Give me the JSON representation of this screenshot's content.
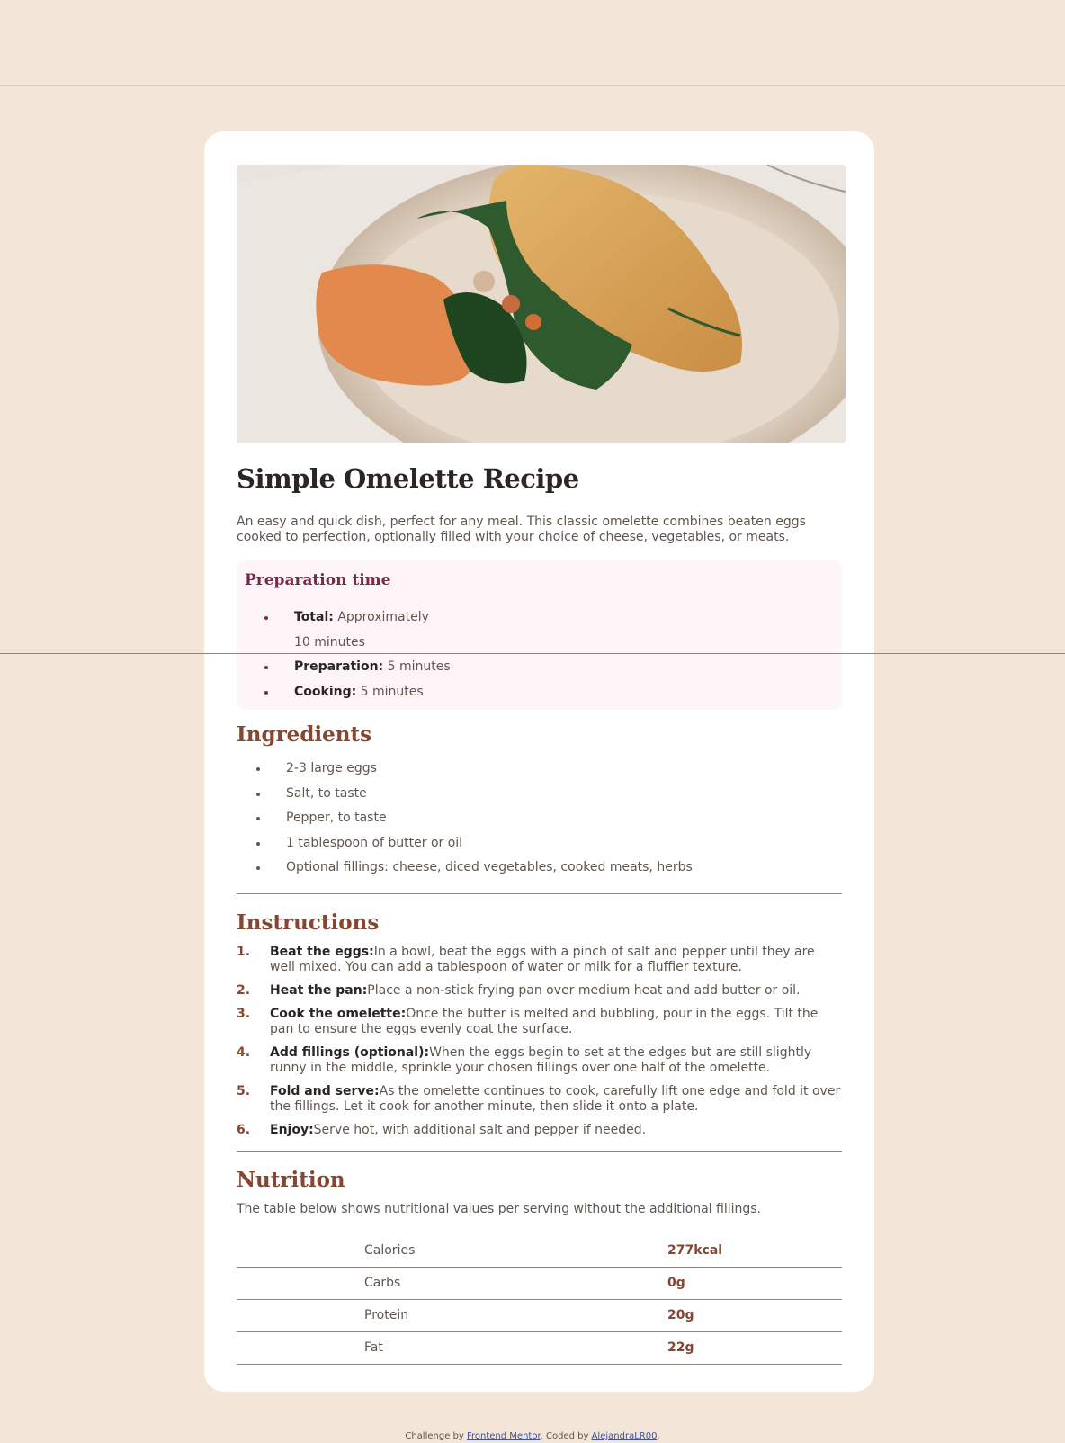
{
  "recipe": {
    "title": "Simple Omelette Recipe",
    "intro": "An easy and quick dish, perfect for any meal. This classic omelette combines beaten eggs cooked to perfection, optionally filled with your choice of cheese, vegetables, or meats."
  },
  "prep": {
    "heading": "Preparation time",
    "items": [
      {
        "label": "Total:",
        "value": "Approximately 10 minutes"
      },
      {
        "label": "Preparation:",
        "value": "5 minutes"
      },
      {
        "label": "Cooking:",
        "value": "5 minutes"
      }
    ]
  },
  "ingredients": {
    "heading": "Ingredients",
    "items": [
      "2-3 large eggs",
      "Salt, to taste",
      "Pepper, to taste",
      "1 tablespoon of butter or oil",
      "Optional fillings: cheese, diced vegetables, cooked meats, herbs"
    ]
  },
  "instructions": {
    "heading": "Instructions",
    "steps": [
      {
        "num": "1.",
        "label": "Beat the eggs:",
        "text": "In a bowl, beat the eggs with a pinch of salt and pepper until they are well mixed. You can add a tablespoon of water or milk for a fluffier texture."
      },
      {
        "num": "2.",
        "label": "Heat the pan:",
        "text": "Place a non-stick frying pan over medium heat and add butter or oil."
      },
      {
        "num": "3.",
        "label": "Cook the omelette:",
        "text": "Once the butter is melted and bubbling, pour in the eggs. Tilt the pan to ensure the eggs evenly coat the surface."
      },
      {
        "num": "4.",
        "label": "Add fillings (optional):",
        "text": "When the eggs begin to set at the edges but are still slightly runny in the middle, sprinkle your chosen fillings over one half of the omelette."
      },
      {
        "num": "5.",
        "label": "Fold and serve:",
        "text": "As the omelette continues to cook, carefully lift one edge and fold it over the fillings. Let it cook for another minute, then slide it onto a plate."
      },
      {
        "num": "6.",
        "label": "Enjoy:",
        "text": "Serve hot, with additional salt and pepper if needed."
      }
    ]
  },
  "nutrition": {
    "heading": "Nutrition",
    "description": "The table below shows nutritional values per serving without the additional fillings.",
    "rows": [
      {
        "label": "Calories",
        "value": "277kcal"
      },
      {
        "label": "Carbs",
        "value": "0g"
      },
      {
        "label": "Protein",
        "value": "20g"
      },
      {
        "label": "Fat",
        "value": "22g"
      }
    ]
  },
  "footer": {
    "prefix": "Challenge by ",
    "challenge_link": "Frontend Mentor",
    "middle": ". Coded by ",
    "author_link": "AlejandraLR00",
    "suffix": "."
  },
  "colors": {
    "background": "#f3e5d8",
    "card": "#ffffff",
    "accent_brown": "#854632",
    "accent_rose": "#7a284a",
    "prep_bg": "#fdf5f8",
    "text": "#5f564d",
    "dark": "#2b2624"
  }
}
